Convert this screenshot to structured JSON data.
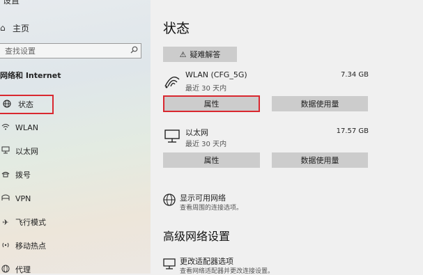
{
  "sidebar": {
    "top_partial": "设置",
    "home_label": "主页",
    "search_placeholder": "查找设置",
    "section_title": "网络和 Internet",
    "items": [
      {
        "label": "状态",
        "icon": "globe-icon"
      },
      {
        "label": "WLAN",
        "icon": "wifi-icon"
      },
      {
        "label": "以太网",
        "icon": "ethernet-icon"
      },
      {
        "label": "拨号",
        "icon": "dialup-icon"
      },
      {
        "label": "VPN",
        "icon": "vpn-icon"
      },
      {
        "label": "飞行模式",
        "icon": "airplane-icon"
      },
      {
        "label": "移动热点",
        "icon": "hotspot-icon"
      },
      {
        "label": "代理",
        "icon": "globe-icon"
      }
    ]
  },
  "main": {
    "title": "状态",
    "troubleshoot_label": "疑难解答",
    "networks": [
      {
        "name": "WLAN (CFG_5G)",
        "sub": "最近 30 天内",
        "size": "7.34 GB",
        "btn_props": "属性",
        "btn_usage": "数据使用量"
      },
      {
        "name": "以太网",
        "sub": "最近 30 天内",
        "size": "17.57 GB",
        "btn_props": "属性",
        "btn_usage": "数据使用量"
      }
    ],
    "show_networks": {
      "title": "显示可用网络",
      "sub": "查看周围的连接选项。"
    },
    "advanced_title": "高级网络设置",
    "adapter": {
      "title": "更改适配器选项",
      "sub": "查看网络适配器并更改连接设置。"
    }
  },
  "colors": {
    "highlight": "#d9272f",
    "button": "#cccccc"
  }
}
